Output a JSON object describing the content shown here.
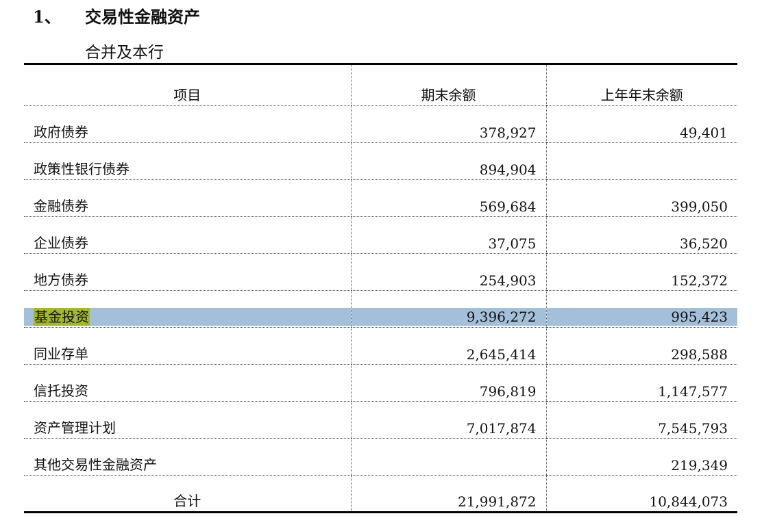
{
  "heading": {
    "number": "1、",
    "title": "交易性金融资产"
  },
  "subheading": "合并及本行",
  "table": {
    "headers": [
      "项目",
      "期末余额",
      "上年年末余额"
    ],
    "rows": [
      {
        "item": "政府债券",
        "current": "378,927",
        "prior": "49,401"
      },
      {
        "item": "政策性银行债券",
        "current": "894,904",
        "prior": ""
      },
      {
        "item": "金融债券",
        "current": "569,684",
        "prior": "399,050"
      },
      {
        "item": "企业债券",
        "current": "37,075",
        "prior": "36,520"
      },
      {
        "item": "地方债券",
        "current": "254,903",
        "prior": "152,372"
      },
      {
        "item": "基金投资",
        "current": "9,396,272",
        "prior": "995,423"
      },
      {
        "item": "同业存单",
        "current": "2,645,414",
        "prior": "298,588"
      },
      {
        "item": "信托投资",
        "current": "796,819",
        "prior": "1,147,577"
      },
      {
        "item": "资产管理计划",
        "current": "7,017,874",
        "prior": "7,545,793"
      },
      {
        "item": "其他交易性金融资产",
        "current": "",
        "prior": "219,349"
      }
    ],
    "total": {
      "item": "合计",
      "current": "21,991,872",
      "prior": "10,844,073"
    }
  },
  "colors": {
    "row_highlight": "#a4bfd9",
    "text_highlight": "#a3b82e"
  }
}
